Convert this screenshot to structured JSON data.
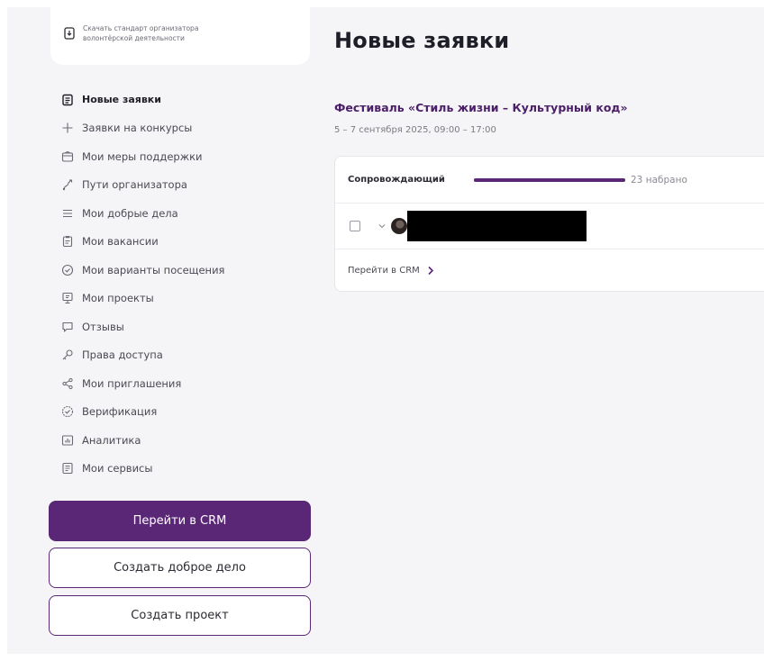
{
  "sidebar": {
    "download_text": "Скачать стандарт организатора волонтёрской деятельности",
    "items": [
      {
        "label": "Новые заявки",
        "icon": "document-icon"
      },
      {
        "label": "Заявки на конкурсы",
        "icon": "plus-icon"
      },
      {
        "label": "Мои меры поддержки",
        "icon": "wallet-icon"
      },
      {
        "label": "Пути организатора",
        "icon": "route-icon"
      },
      {
        "label": "Мои добрые дела",
        "icon": "list-icon"
      },
      {
        "label": "Мои вакансии",
        "icon": "clipboard-icon"
      },
      {
        "label": "Мои варианты посещения",
        "icon": "check-circle-icon"
      },
      {
        "label": "Мои проекты",
        "icon": "presentation-icon"
      },
      {
        "label": "Отзывы",
        "icon": "chat-icon"
      },
      {
        "label": "Права доступа",
        "icon": "key-icon"
      },
      {
        "label": "Мои приглашения",
        "icon": "share-icon"
      },
      {
        "label": "Верификация",
        "icon": "verified-icon"
      },
      {
        "label": "Аналитика",
        "icon": "chart-icon"
      },
      {
        "label": "Мои сервисы",
        "icon": "services-icon"
      }
    ],
    "buttons": {
      "crm": "Перейти в CRM",
      "create_good_deed": "Создать доброе дело",
      "create_project": "Создать проект"
    }
  },
  "main": {
    "title": "Новые заявки",
    "event": {
      "title": "Фестиваль «Стиль жизни – Культурный код»",
      "date": "5 – 7 сентября 2025, 09:00 – 17:00",
      "role": "Сопровождающий",
      "progress": 1.0,
      "count": "23 набрано",
      "crm_link": "Перейти в CRM"
    }
  },
  "colors": {
    "accent": "#5a2777",
    "event_title": "#4b1f68",
    "background": "#f5f5f7"
  }
}
